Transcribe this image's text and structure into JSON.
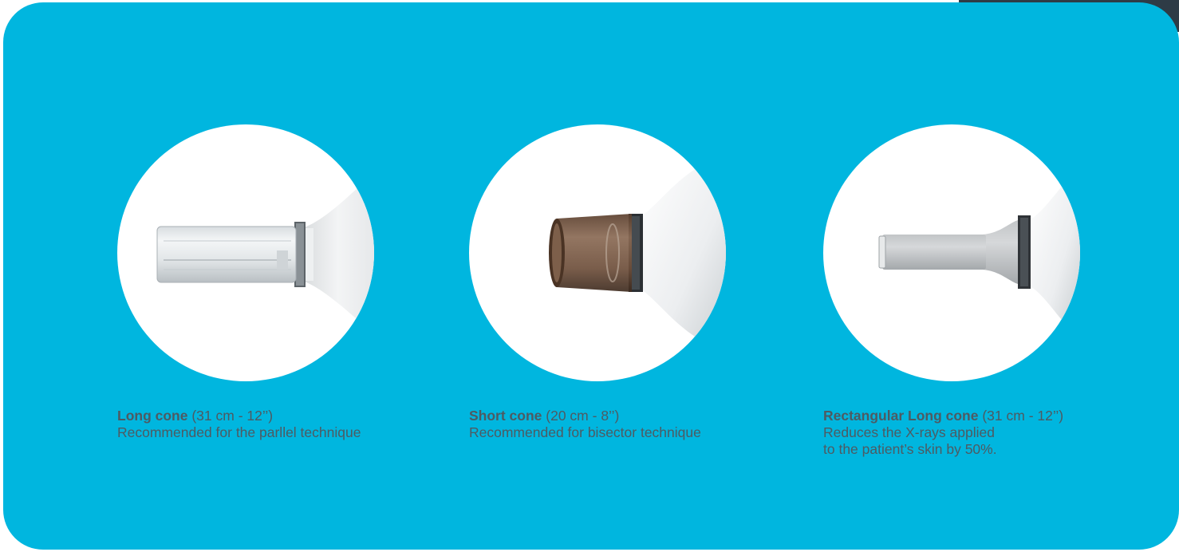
{
  "colors": {
    "panel": "#00b6df",
    "corner_tab": "#2e3b46",
    "caption_text": "#4e5a62"
  },
  "cones": [
    {
      "name": "Long cone",
      "spec": "(31 cm - 12’’)",
      "description": [
        "Recommended for the parllel technique"
      ],
      "image": "long-cylindrical-cone-image"
    },
    {
      "name": "Short cone",
      "spec": "(20 cm - 8’’)",
      "description": [
        "Recommended for bisector technique"
      ],
      "image": "short-tinted-cone-image"
    },
    {
      "name": "Rectangular Long cone",
      "spec": "(31 cm - 12’’)",
      "description": [
        "Reduces the X-rays applied",
        "to the patient’s skin by 50%."
      ],
      "image": "rectangular-cone-image"
    }
  ]
}
